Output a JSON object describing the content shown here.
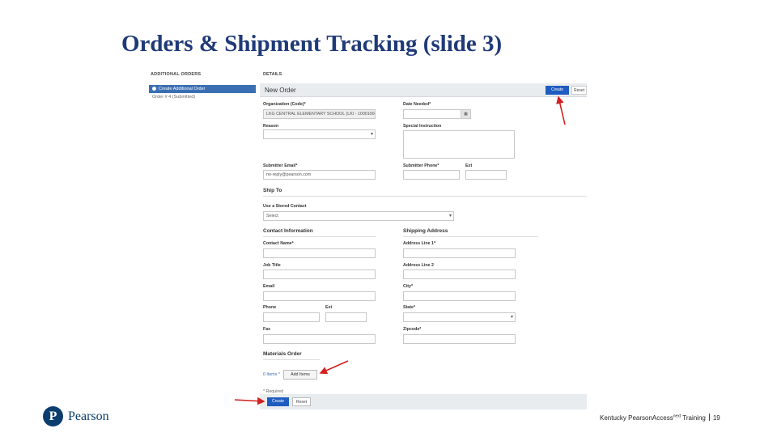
{
  "slide": {
    "title": "Orders & Shipment Tracking (slide 3)",
    "footer_text": "Kentucky PearsonAccess",
    "footer_superscript": "next",
    "footer_suffix": "Training",
    "page_number": "19"
  },
  "brand": {
    "logo_text": "Pearson",
    "logo_letter": "P",
    "color": "#0b3d6e"
  },
  "left_panel": {
    "heading": "ADDITIONAL ORDERS",
    "active_item": "Create Additional Order",
    "items": [
      "Order # 4 (Submitted)"
    ]
  },
  "details": {
    "heading": "DETAILS",
    "title": "New Order",
    "create_label": "Create",
    "reset_label": "Reset",
    "organization_label": "Organization (Code)*",
    "organization_value": "LKG CENTRAL ELEMENTARY SCHOOL (LKI - 100010045)",
    "date_needed_label": "Date Needed*",
    "reason_label": "Reason",
    "special_instruction_label": "Special Instruction",
    "submitter_email_label": "Submitter Email*",
    "submitter_email_value": "no-reply@pearson.com",
    "submitter_phone_label": "Submitter Phone*",
    "ext_label": "Ext",
    "ship_to_heading": "Ship To",
    "stored_contact_label": "Use a Stored Contact",
    "stored_contact_value": "Select",
    "contact_heading": "Contact Information",
    "shipping_heading": "Shipping Address",
    "contact_name_label": "Contact Name*",
    "job_title_label": "Job Title",
    "email_label": "Email",
    "phone_label": "Phone",
    "phone_ext_label": "Ext",
    "fax_label": "Fax",
    "address1_label": "Address Line 1*",
    "address2_label": "Address Line 2",
    "city_label": "City*",
    "state_label": "State*",
    "zipcode_label": "Zipcode*",
    "materials_heading": "Materials Order",
    "items_label": "0 Items *",
    "add_items_label": "Add Items",
    "required_note": "* Required",
    "bottom_create_label": "Create",
    "bottom_reset_label": "Reset",
    "accent_color": "#1f5cbf"
  },
  "annotations": {
    "arrow_color": "#d42020"
  }
}
